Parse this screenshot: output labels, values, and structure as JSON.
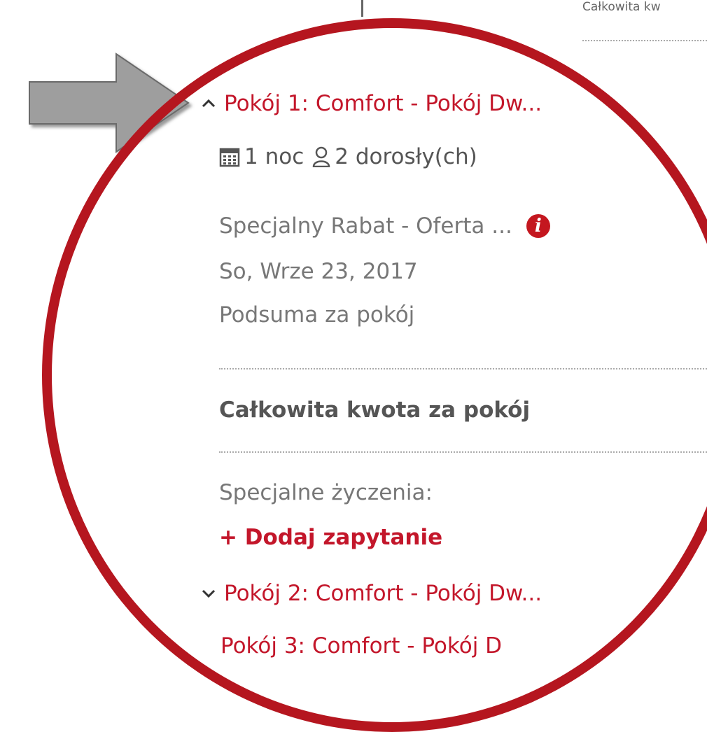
{
  "top": {
    "total_label": "Całkowita kw"
  },
  "rooms": [
    {
      "title": "Pokój 1: Comfort - Pokój Dw...",
      "expanded": true,
      "nights": "1 noc",
      "guests": "2 dorosły(ch)",
      "rate_name": "Specjalny Rabat - Oferta ...",
      "date": "So, Wrze 23, 2017",
      "subtotal_label": "Podsuma za pokój",
      "total_label": "Całkowita kwota za pokój",
      "requests_label": "Specjalne życzenia:",
      "add_request_label": "+ Dodaj zapytanie"
    },
    {
      "title": "Pokój 2: Comfort - Pokój Dw...",
      "expanded": false
    },
    {
      "title": "Pokój 3: Comfort - Pokój D",
      "expanded": false
    }
  ],
  "icons": {
    "info": "i",
    "calendar": "calendar-icon",
    "person": "person-icon",
    "chevron_up": "chevron-up-icon",
    "chevron_down": "chevron-down-icon"
  },
  "colors": {
    "accent": "#c3162a",
    "magnifier_ring": "#b5161f",
    "arrow": "#9e9e9e",
    "text": "#555555"
  }
}
